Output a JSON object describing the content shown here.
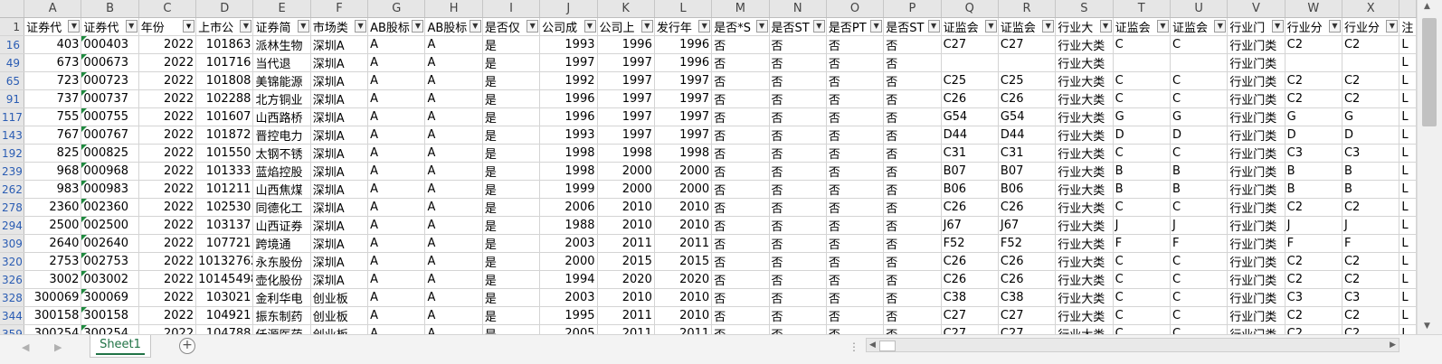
{
  "columns": [
    "A",
    "B",
    "C",
    "D",
    "E",
    "F",
    "G",
    "H",
    "I",
    "J",
    "K",
    "L",
    "M",
    "N",
    "O",
    "P",
    "Q",
    "R",
    "S",
    "T",
    "U",
    "V",
    "W",
    "X",
    ""
  ],
  "header_row": {
    "row_label": "1",
    "cells": [
      "证券代",
      "证券代",
      "年份",
      "上市公",
      "证券简",
      "市场类",
      "AB股标",
      "AB股标",
      "是否仅",
      "公司成",
      "公司上",
      "发行年",
      "是否*S",
      "是否ST",
      "是否PT",
      "是否ST",
      "证监会",
      "证监会",
      "行业大",
      "证监会",
      "证监会",
      "行业门",
      "行业分",
      "行业分",
      "注"
    ],
    "filtered_column": "C"
  },
  "rows": [
    {
      "r": "16",
      "c": [
        "403",
        "000403",
        "2022",
        "101863",
        "派林生物",
        "深圳A",
        "A",
        "A",
        "是",
        "1993",
        "1996",
        "1996",
        "否",
        "否",
        "否",
        "否",
        "C27",
        "C27",
        "行业大类",
        "C",
        "C",
        "行业门类",
        "C2",
        "C2",
        "L"
      ]
    },
    {
      "r": "49",
      "c": [
        "673",
        "000673",
        "2022",
        "101716",
        "当代退",
        "深圳A",
        "A",
        "A",
        "是",
        "1997",
        "1997",
        "1996",
        "否",
        "否",
        "否",
        "否",
        "",
        "",
        "行业大类",
        "",
        "",
        "行业门类",
        "",
        "",
        "L"
      ]
    },
    {
      "r": "65",
      "c": [
        "723",
        "000723",
        "2022",
        "101808",
        "美锦能源",
        "深圳A",
        "A",
        "A",
        "是",
        "1992",
        "1997",
        "1997",
        "否",
        "否",
        "否",
        "否",
        "C25",
        "C25",
        "行业大类",
        "C",
        "C",
        "行业门类",
        "C2",
        "C2",
        "L"
      ]
    },
    {
      "r": "91",
      "c": [
        "737",
        "000737",
        "2022",
        "102288",
        "北方铜业",
        "深圳A",
        "A",
        "A",
        "是",
        "1996",
        "1997",
        "1997",
        "否",
        "否",
        "否",
        "否",
        "C26",
        "C26",
        "行业大类",
        "C",
        "C",
        "行业门类",
        "C2",
        "C2",
        "L"
      ]
    },
    {
      "r": "117",
      "c": [
        "755",
        "000755",
        "2022",
        "101607",
        "山西路桥",
        "深圳A",
        "A",
        "A",
        "是",
        "1996",
        "1997",
        "1997",
        "否",
        "否",
        "否",
        "否",
        "G54",
        "G54",
        "行业大类",
        "G",
        "G",
        "行业门类",
        "G",
        "G",
        "L"
      ]
    },
    {
      "r": "143",
      "c": [
        "767",
        "000767",
        "2022",
        "101872",
        "晋控电力",
        "深圳A",
        "A",
        "A",
        "是",
        "1993",
        "1997",
        "1997",
        "否",
        "否",
        "否",
        "否",
        "D44",
        "D44",
        "行业大类",
        "D",
        "D",
        "行业门类",
        "D",
        "D",
        "L"
      ]
    },
    {
      "r": "192",
      "c": [
        "825",
        "000825",
        "2022",
        "101550",
        "太钢不锈",
        "深圳A",
        "A",
        "A",
        "是",
        "1998",
        "1998",
        "1998",
        "否",
        "否",
        "否",
        "否",
        "C31",
        "C31",
        "行业大类",
        "C",
        "C",
        "行业门类",
        "C3",
        "C3",
        "L"
      ]
    },
    {
      "r": "239",
      "c": [
        "968",
        "000968",
        "2022",
        "101333",
        "蓝焰控股",
        "深圳A",
        "A",
        "A",
        "是",
        "1998",
        "2000",
        "2000",
        "否",
        "否",
        "否",
        "否",
        "B07",
        "B07",
        "行业大类",
        "B",
        "B",
        "行业门类",
        "B",
        "B",
        "L"
      ]
    },
    {
      "r": "262",
      "c": [
        "983",
        "000983",
        "2022",
        "101211",
        "山西焦煤",
        "深圳A",
        "A",
        "A",
        "是",
        "1999",
        "2000",
        "2000",
        "否",
        "否",
        "否",
        "否",
        "B06",
        "B06",
        "行业大类",
        "B",
        "B",
        "行业门类",
        "B",
        "B",
        "L"
      ]
    },
    {
      "r": "278",
      "c": [
        "2360",
        "002360",
        "2022",
        "102530",
        "同德化工",
        "深圳A",
        "A",
        "A",
        "是",
        "2006",
        "2010",
        "2010",
        "否",
        "否",
        "否",
        "否",
        "C26",
        "C26",
        "行业大类",
        "C",
        "C",
        "行业门类",
        "C2",
        "C2",
        "L"
      ]
    },
    {
      "r": "294",
      "c": [
        "2500",
        "002500",
        "2022",
        "103137",
        "山西证券",
        "深圳A",
        "A",
        "A",
        "是",
        "1988",
        "2010",
        "2010",
        "否",
        "否",
        "否",
        "否",
        "J67",
        "J67",
        "行业大类",
        "J",
        "J",
        "行业门类",
        "J",
        "J",
        "L"
      ]
    },
    {
      "r": "309",
      "c": [
        "2640",
        "002640",
        "2022",
        "107721",
        "跨境通",
        "深圳A",
        "A",
        "A",
        "是",
        "2003",
        "2011",
        "2011",
        "否",
        "否",
        "否",
        "否",
        "F52",
        "F52",
        "行业大类",
        "F",
        "F",
        "行业门类",
        "F",
        "F",
        "L"
      ]
    },
    {
      "r": "320",
      "c": [
        "2753",
        "002753",
        "2022",
        "10132762",
        "永东股份",
        "深圳A",
        "A",
        "A",
        "是",
        "2000",
        "2015",
        "2015",
        "否",
        "否",
        "否",
        "否",
        "C26",
        "C26",
        "行业大类",
        "C",
        "C",
        "行业门类",
        "C2",
        "C2",
        "L"
      ]
    },
    {
      "r": "326",
      "c": [
        "3002",
        "003002",
        "2022",
        "10145498",
        "壶化股份",
        "深圳A",
        "A",
        "A",
        "是",
        "1994",
        "2020",
        "2020",
        "否",
        "否",
        "否",
        "否",
        "C26",
        "C26",
        "行业大类",
        "C",
        "C",
        "行业门类",
        "C2",
        "C2",
        "L"
      ]
    },
    {
      "r": "328",
      "c": [
        "300069",
        "300069",
        "2022",
        "103021",
        "金利华电",
        "创业板",
        "A",
        "A",
        "是",
        "2003",
        "2010",
        "2010",
        "否",
        "否",
        "否",
        "否",
        "C38",
        "C38",
        "行业大类",
        "C",
        "C",
        "行业门类",
        "C3",
        "C3",
        "L"
      ]
    },
    {
      "r": "344",
      "c": [
        "300158",
        "300158",
        "2022",
        "104921",
        "振东制药",
        "创业板",
        "A",
        "A",
        "是",
        "1995",
        "2011",
        "2010",
        "否",
        "否",
        "否",
        "否",
        "C27",
        "C27",
        "行业大类",
        "C",
        "C",
        "行业门类",
        "C2",
        "C2",
        "L"
      ]
    },
    {
      "r": "359",
      "c": [
        "300254",
        "300254",
        "2022",
        "104788",
        "仟源医药",
        "创业板",
        "A",
        "A",
        "是",
        "2005",
        "2011",
        "2011",
        "否",
        "否",
        "否",
        "否",
        "C27",
        "C27",
        "行业大类",
        "C",
        "C",
        "行业门类",
        "C2",
        "C2",
        "L"
      ]
    }
  ],
  "numeric_columns": [
    0,
    2,
    3,
    9,
    10,
    11
  ],
  "text_number_columns": [
    1
  ],
  "sheet_tab": "Sheet1",
  "icons": {
    "filter_dropdown": "▼",
    "filter_active": "▼",
    "add_sheet": "+",
    "scroll_up": "▲",
    "scroll_down": "▼",
    "scroll_left": "◀",
    "scroll_right": "▶",
    "nav_prev": "◀",
    "nav_next": "▶",
    "split_handle": "⋮"
  }
}
